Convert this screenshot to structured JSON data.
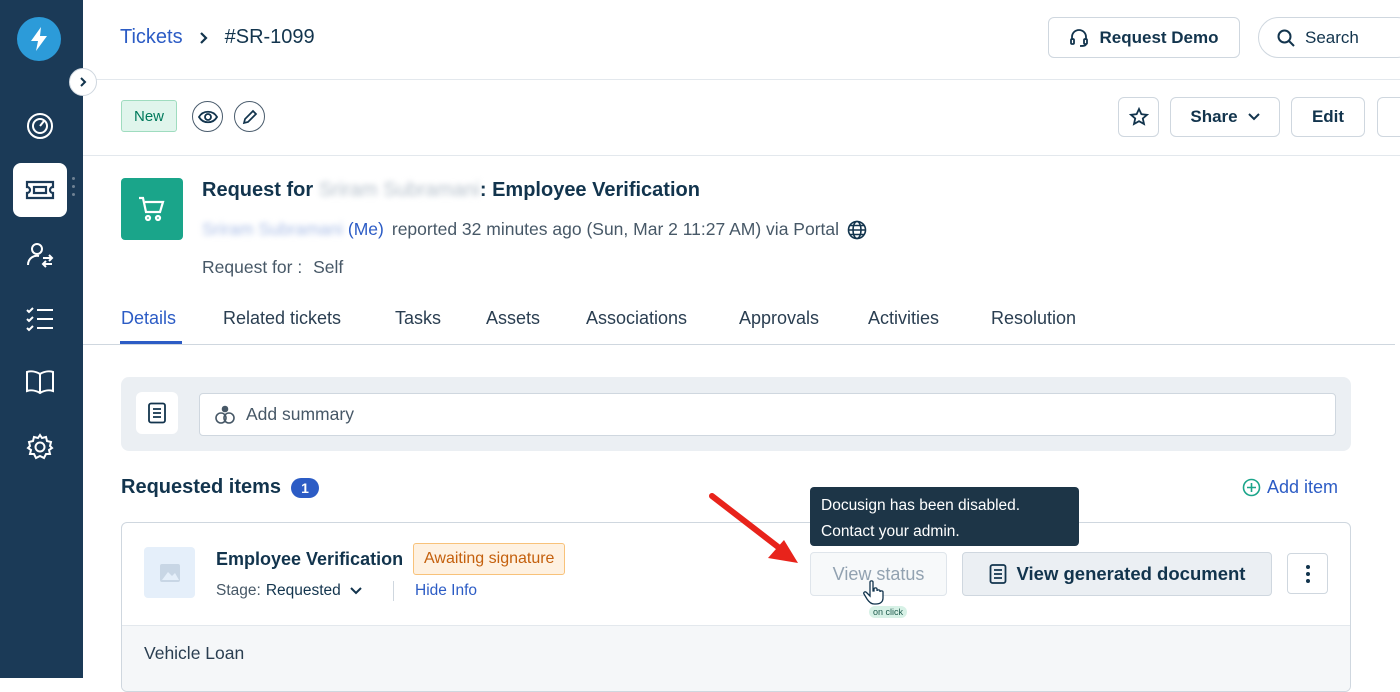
{
  "breadcrumb": {
    "parent": "Tickets",
    "current": "#SR-1099"
  },
  "header": {
    "request_demo": "Request Demo",
    "search_placeholder": "Search"
  },
  "toolbar": {
    "status_badge": "New",
    "share_label": "Share",
    "edit_label": "Edit"
  },
  "ticket": {
    "title_prefix": "Request for",
    "title_name_redacted": "Sriram Subramani",
    "title_suffix": ": Employee Verification",
    "reporter_redacted": "Sriram Subramani",
    "reporter_me": "(Me)",
    "reported_text": "reported 32 minutes ago (Sun, Mar 2 11:27 AM) via Portal",
    "request_for_label": "Request for :",
    "request_for_value": "Self"
  },
  "tabs": [
    {
      "label": "Details",
      "active": true
    },
    {
      "label": "Related tickets"
    },
    {
      "label": "Tasks"
    },
    {
      "label": "Assets"
    },
    {
      "label": "Associations"
    },
    {
      "label": "Approvals"
    },
    {
      "label": "Activities"
    },
    {
      "label": "Resolution"
    }
  ],
  "summary": {
    "placeholder": "Add summary"
  },
  "requested_items": {
    "title": "Requested items",
    "count": "1",
    "add_label": "Add item",
    "items": [
      {
        "name": "Employee Verification",
        "status": "Awaiting signature",
        "stage_label": "Stage:",
        "stage_value": "Requested",
        "hide_info": "Hide Info",
        "view_status": "View status",
        "view_document": "View generated document",
        "detail": "Vehicle Loan"
      }
    ]
  },
  "tooltip": {
    "line1": "Docusign has been disabled.",
    "line2": "Contact your admin."
  },
  "cursor_hint": "on click",
  "colors": {
    "sidebar": "#1b3a57",
    "accent": "#2c5cc5",
    "status_new": "#00795b",
    "awaiting": "#c4600d",
    "annotation_arrow": "#e8231b"
  }
}
